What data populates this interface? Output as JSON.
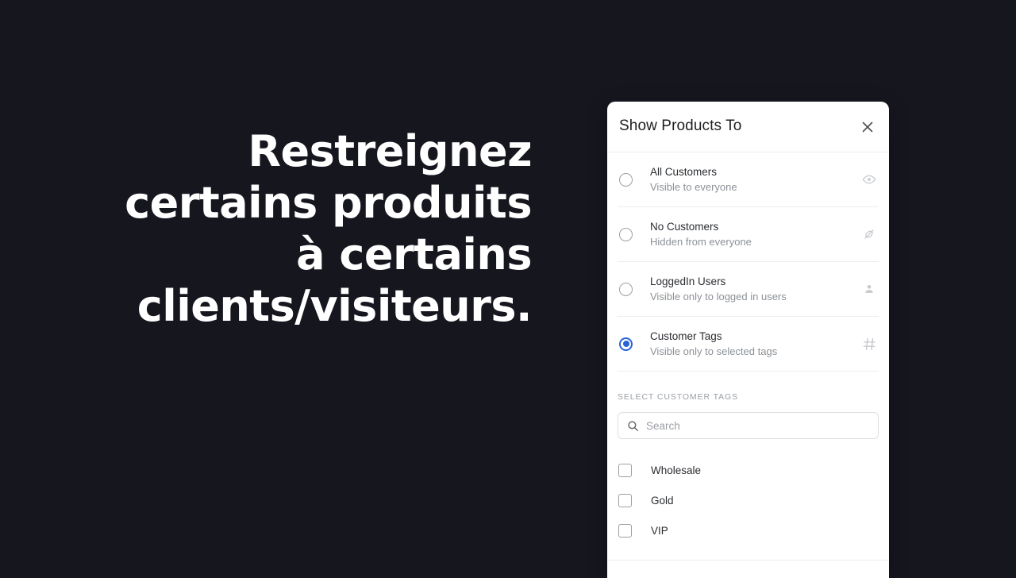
{
  "page": {
    "background_color": "#16161f",
    "headline": "Restreignez certains produits à certains clients/visiteurs."
  },
  "panel": {
    "title": "Show Products To",
    "close_icon": "close-icon",
    "accent_color": "#2a63d6",
    "options": [
      {
        "title": "All Customers",
        "subtitle": "Visible to everyone",
        "icon": "eye-icon",
        "selected": false
      },
      {
        "title": "No Customers",
        "subtitle": "Hidden from everyone",
        "icon": "eye-off-icon",
        "selected": false
      },
      {
        "title": "LoggedIn Users",
        "subtitle": "Visible only to logged in users",
        "icon": "user-icon",
        "selected": false
      },
      {
        "title": "Customer Tags",
        "subtitle": "Visible only to selected tags",
        "icon": "hash-icon",
        "selected": true
      }
    ],
    "tags_section": {
      "label": "SELECT CUSTOMER TAGS",
      "search": {
        "icon": "search-icon",
        "value": "",
        "placeholder": "Search"
      },
      "tags": [
        {
          "label": "Wholesale",
          "checked": false
        },
        {
          "label": "Gold",
          "checked": false
        },
        {
          "label": "VIP",
          "checked": false
        }
      ]
    }
  }
}
